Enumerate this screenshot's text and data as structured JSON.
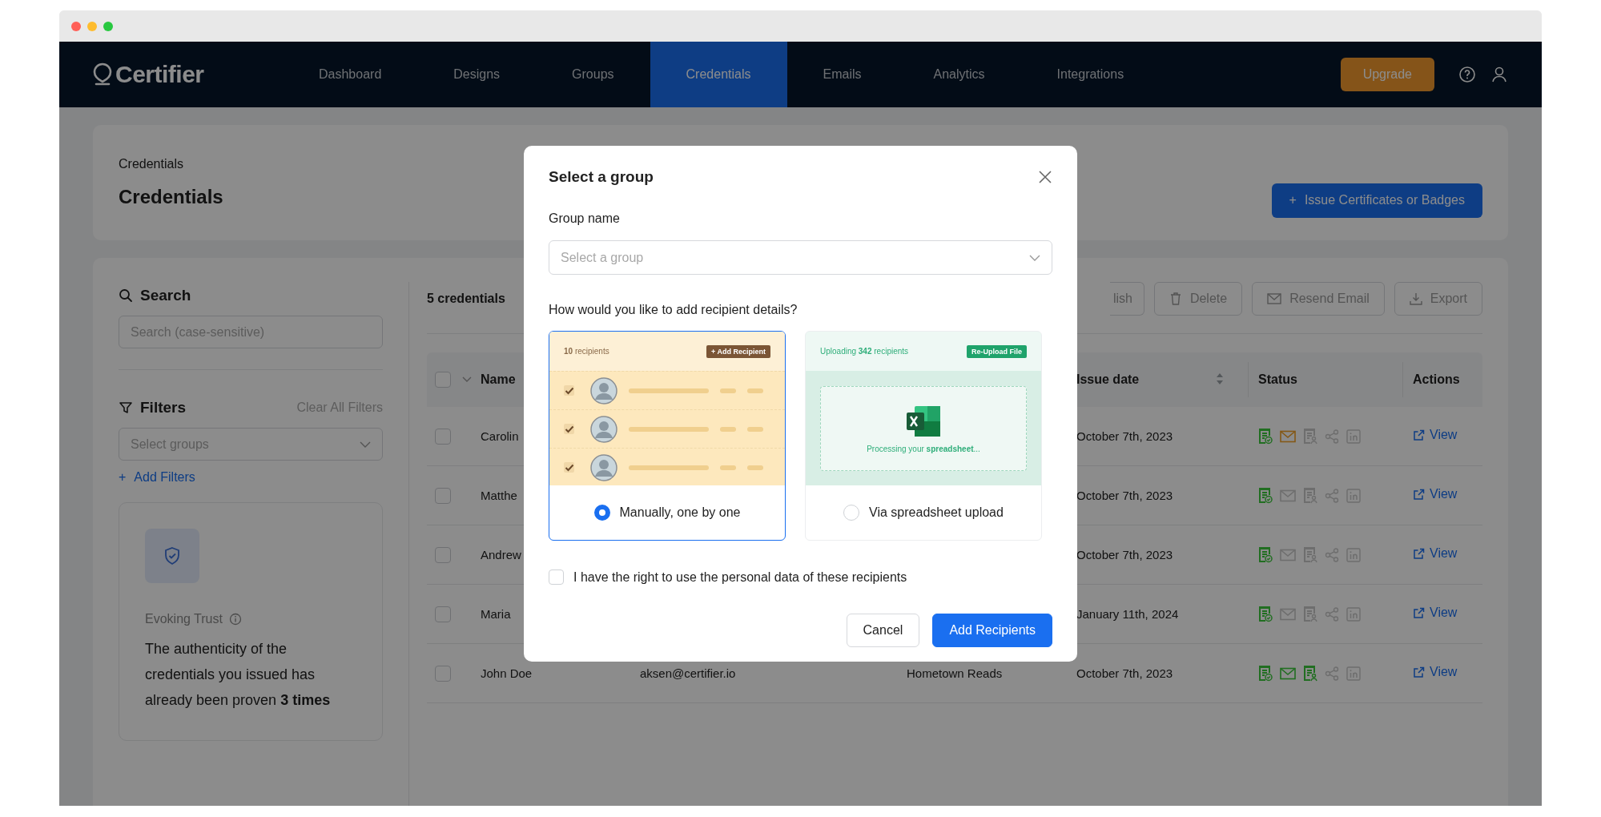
{
  "nav": {
    "logo": "Certifier",
    "items": [
      {
        "label": "Dashboard",
        "selected": false
      },
      {
        "label": "Designs",
        "selected": false
      },
      {
        "label": "Groups",
        "selected": false
      },
      {
        "label": "Credentials",
        "selected": true
      },
      {
        "label": "Emails",
        "selected": false
      },
      {
        "label": "Analytics",
        "selected": false
      },
      {
        "label": "Integrations",
        "selected": false
      }
    ],
    "upgrade": "Upgrade"
  },
  "header": {
    "breadcrumb": "Credentials",
    "title": "Credentials",
    "issue_button": {
      "icon": "+",
      "label": "Issue Certificates or Badges"
    }
  },
  "sidebar": {
    "search_label": "Search",
    "search_placeholder": "Search (case-sensitive)",
    "filters_label": "Filters",
    "clear_filters": "Clear All Filters",
    "groups_placeholder": "Select groups",
    "add_filters": {
      "icon": "+",
      "label": "Add Filters"
    },
    "trust": {
      "title": "Evoking Trust",
      "text": "The authenticity of the credentials you issued has already been proven **3 times**"
    }
  },
  "table": {
    "count": "5 credentials",
    "toolbar": [
      {
        "kind": "partial",
        "label": "lish",
        "disabled": true
      },
      {
        "kind": "delete",
        "label": "Delete",
        "disabled": true
      },
      {
        "kind": "email",
        "label": "Resend Email",
        "disabled": true
      },
      {
        "kind": "export",
        "label": "Export",
        "disabled": true
      }
    ],
    "all_checked": false,
    "columns": {
      "name": "Name",
      "issue_date": "Issue date",
      "status": "Status",
      "actions": "Actions"
    },
    "rows": [
      {
        "checked": false,
        "name": "Carolin",
        "issue_date": "October 7th, 2023",
        "status": [
          {
            "kind": "certificate",
            "color": "#216e21"
          },
          {
            "kind": "email",
            "color": "#845816"
          },
          {
            "kind": "badge",
            "color": "#6e6e6e"
          },
          {
            "kind": "share",
            "color": "#6e6e6e"
          },
          {
            "kind": "in",
            "color": "#6e6e6e"
          }
        ],
        "action": "View"
      },
      {
        "checked": false,
        "name": "Matthe",
        "issue_date": "October 7th, 2023",
        "status": [
          {
            "kind": "certificate",
            "color": "#216e21"
          },
          {
            "kind": "email",
            "color": "#6e6e6e"
          },
          {
            "kind": "badge",
            "color": "#6e6e6e"
          },
          {
            "kind": "share",
            "color": "#6e6e6e"
          },
          {
            "kind": "in",
            "color": "#6e6e6e"
          }
        ],
        "action": "View"
      },
      {
        "checked": false,
        "name": "Andrew",
        "issue_date": "October 7th, 2023",
        "status": [
          {
            "kind": "certificate",
            "color": "#216e21"
          },
          {
            "kind": "email",
            "color": "#6e6e6e"
          },
          {
            "kind": "badge",
            "color": "#6e6e6e"
          },
          {
            "kind": "share",
            "color": "#6e6e6e"
          },
          {
            "kind": "in",
            "color": "#6e6e6e"
          }
        ],
        "action": "View"
      },
      {
        "checked": false,
        "name": "Maria",
        "issue_date": "January 11th, 2024",
        "status": [
          {
            "kind": "certificate",
            "color": "#216e21"
          },
          {
            "kind": "email",
            "color": "#6e6e6e"
          },
          {
            "kind": "badge",
            "color": "#6e6e6e"
          },
          {
            "kind": "share",
            "color": "#6e6e6e"
          },
          {
            "kind": "in",
            "color": "#6e6e6e"
          }
        ],
        "action": "View"
      },
      {
        "checked": false,
        "name": "John Doe",
        "email": "aksen@certifier.io",
        "group": "Hometown Reads",
        "issue_date": "October 7th, 2023",
        "status": [
          {
            "kind": "certificate",
            "color": "#216e21"
          },
          {
            "kind": "email",
            "color": "#216e21"
          },
          {
            "kind": "badge",
            "color": "#216e21"
          },
          {
            "kind": "share",
            "color": "#6e6e6e"
          },
          {
            "kind": "in",
            "color": "#6e6e6e"
          }
        ],
        "action": "View"
      }
    ]
  },
  "modal": {
    "title": "Select a group",
    "group_label": "Group name",
    "group_placeholder": "Select a group",
    "question": "How would you like to add recipient details?",
    "options": [
      {
        "kind": "manual",
        "selected": true,
        "label": "Manually, one by one",
        "header": "**10** recipients",
        "action": "+ Add Recipient",
        "rows": [
          {
            "checked": true
          },
          {
            "checked": true
          },
          {
            "checked": true
          }
        ]
      },
      {
        "kind": "spreadsheet",
        "selected": false,
        "label": "Via spreadsheet upload",
        "header": "Uploading **342** recipients",
        "action": "Re-Upload File",
        "note": "Processing your **spreadsheet**..."
      }
    ],
    "consent": {
      "checked": false,
      "label": "I have the right to use the personal data of these recipients"
    },
    "buttons": [
      {
        "kind": "secondary",
        "label": "Cancel"
      },
      {
        "kind": "primary",
        "label": "Add Recipients"
      }
    ]
  }
}
